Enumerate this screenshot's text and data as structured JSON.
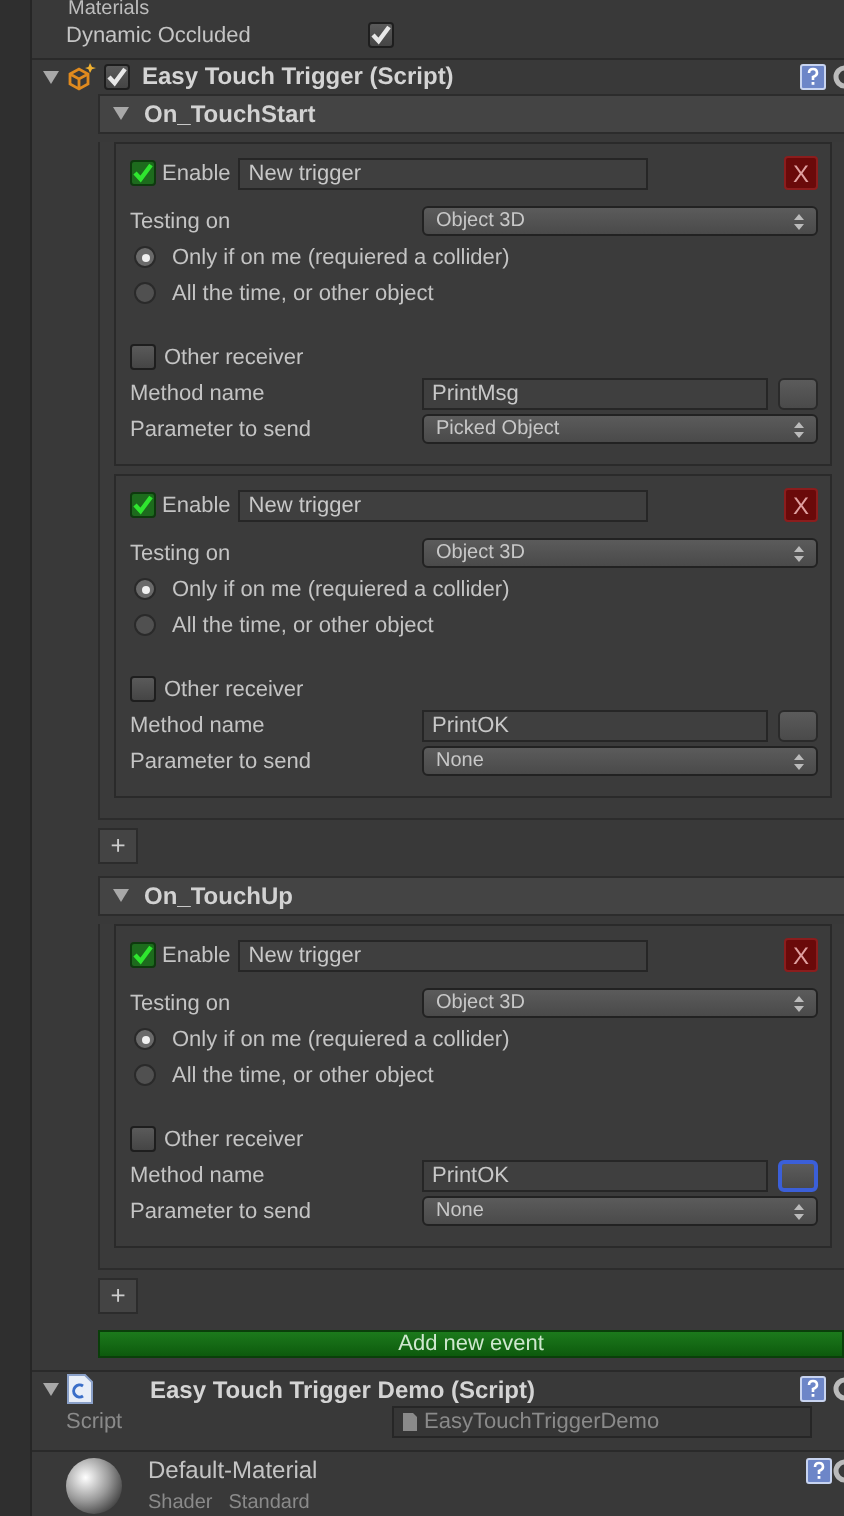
{
  "materials_label": "Materials",
  "dynamic_occluded": {
    "label": "Dynamic Occluded",
    "checked": true
  },
  "component": {
    "title": "Easy Touch Trigger (Script)",
    "enabled": true,
    "expanded": true
  },
  "events": [
    {
      "name": "On_TouchStart",
      "expanded": true,
      "add_button": "+",
      "triggers": [
        {
          "enabled": true,
          "enable_label": "Enable",
          "name": "New trigger",
          "delete_label": "X",
          "testing_label": "Testing on",
          "testing_value": "Object 3D",
          "options": [
            {
              "label": "Only if on me (requiered a collider)",
              "selected": true
            },
            {
              "label": "All the time, or other object",
              "selected": false
            }
          ],
          "other_receiver": {
            "label": "Other receiver",
            "checked": false
          },
          "method_label": "Method name",
          "method_value": "PrintMsg",
          "method_button_focused": false,
          "parameter_label": "Parameter to send",
          "parameter_value": "Picked Object"
        },
        {
          "enabled": true,
          "enable_label": "Enable",
          "name": "New trigger",
          "delete_label": "X",
          "testing_label": "Testing on",
          "testing_value": "Object 3D",
          "options": [
            {
              "label": "Only if on me (requiered a collider)",
              "selected": true
            },
            {
              "label": "All the time, or other object",
              "selected": false
            }
          ],
          "other_receiver": {
            "label": "Other receiver",
            "checked": false
          },
          "method_label": "Method name",
          "method_value": "PrintOK",
          "method_button_focused": false,
          "parameter_label": "Parameter to send",
          "parameter_value": "None"
        }
      ]
    },
    {
      "name": "On_TouchUp",
      "expanded": true,
      "add_button": "+",
      "triggers": [
        {
          "enabled": true,
          "enable_label": "Enable",
          "name": "New trigger",
          "delete_label": "X",
          "testing_label": "Testing on",
          "testing_value": "Object 3D",
          "options": [
            {
              "label": "Only if on me (requiered a collider)",
              "selected": true
            },
            {
              "label": "All the time, or other object",
              "selected": false
            }
          ],
          "other_receiver": {
            "label": "Other receiver",
            "checked": false
          },
          "method_label": "Method name",
          "method_value": "PrintOK",
          "method_button_focused": true,
          "parameter_label": "Parameter to send",
          "parameter_value": "None"
        }
      ]
    }
  ],
  "add_event_button": "Add new event",
  "demo_component": {
    "title": "Easy Touch Trigger Demo (Script)",
    "expanded": true,
    "script_label": "Script",
    "script_value": "EasyTouchTriggerDemo"
  },
  "material": {
    "name": "Default-Material",
    "shader_label": "Shader",
    "shader_value": "Standard"
  }
}
